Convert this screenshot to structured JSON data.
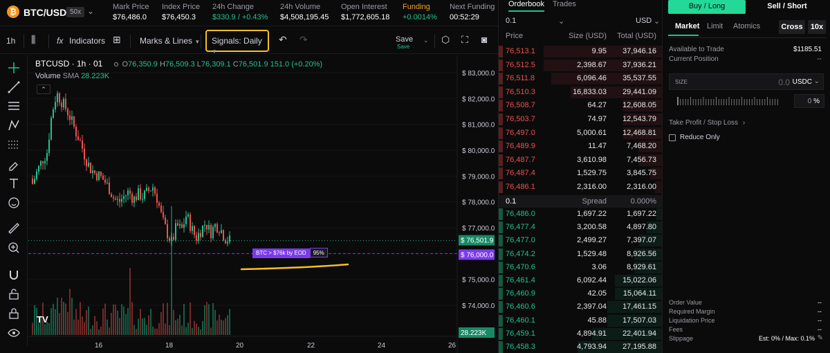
{
  "header": {
    "symbol": "BTC/USD",
    "symbol_icon": "bitcoin-icon",
    "leverage": "50x",
    "stats": [
      {
        "label": "Mark Price",
        "value": "$76,486.0"
      },
      {
        "label": "Index Price",
        "value": "$76,450.3"
      },
      {
        "label": "24h Change",
        "value": "$330.9 / +0.43%"
      },
      {
        "label": "24h Volume",
        "value": "$4,508,195.45"
      },
      {
        "label": "Open Interest",
        "value": "$1,772,605.18"
      },
      {
        "label": "Funding",
        "value": "+0.0014%"
      },
      {
        "label": "Next Funding",
        "value": "00:52:29"
      }
    ]
  },
  "toolbar": {
    "interval": "1h",
    "indicators": "Indicators",
    "marks": "Marks & Lines",
    "signals": "Signals: Daily",
    "save": "Save",
    "save_sub": "Save"
  },
  "chart": {
    "title": "BTCUSD · 1h · 01",
    "ohlc": {
      "o": "76,350.9",
      "h": "76,509.3",
      "l": "76,309.1",
      "c": "76,501.9",
      "chg": "151.0 (+0.20%)"
    },
    "volume_label": "Volume",
    "volume_sma": "SMA",
    "volume_value": "28.223K",
    "signal_text": "BTC > $76k by EOD",
    "signal_pct": "95%",
    "colors": {
      "up": "#22c38e",
      "down": "#f0514b",
      "signal": "#7c3aed",
      "highlight": "#f6c21c"
    }
  },
  "chart_data": {
    "type": "candlestick",
    "y_axis_ticks": [
      "$ 83,000.0",
      "$ 82,000.0",
      "$ 81,000.0",
      "$ 80,000.0",
      "$ 79,000.0",
      "$ 78,000.0",
      "$ 77,000.0",
      "$ 76,000.0",
      "$ 75,000.0",
      "$ 74,000.0"
    ],
    "ylim": [
      73500,
      83500
    ],
    "x_axis_ticks": [
      "16",
      "18",
      "20",
      "22",
      "24",
      "26"
    ],
    "last_price_label": "$ 76,501.9",
    "signal_level_label": "$ 76,000.0",
    "volume_label": "28.223K",
    "close_path": [
      78700,
      79200,
      79600,
      79900,
      81400,
      82200,
      81900,
      81600,
      81200,
      80700,
      80300,
      79700,
      79300,
      79100,
      79000,
      78800,
      78500,
      78100,
      78000,
      78200,
      78400,
      78100,
      78300,
      78200,
      78400,
      78600,
      78100,
      77300,
      76800,
      76400,
      77100,
      76900,
      77500,
      77000,
      76600,
      76900,
      77200,
      76800,
      77100,
      77000,
      76600,
      76500
    ]
  },
  "orderbook": {
    "tabs": [
      "Orderbook",
      "Trades"
    ],
    "precision": "0.1",
    "currency": "USD",
    "columns": [
      "Price",
      "Size (USD)",
      "Total (USD)"
    ],
    "asks": [
      [
        "76,513.1",
        "9.95",
        "37,946.16"
      ],
      [
        "76,512.5",
        "2,398.67",
        "37,936.21"
      ],
      [
        "76,511.8",
        "6,096.46",
        "35,537.55"
      ],
      [
        "76,510.3",
        "16,833.03",
        "29,441.09"
      ],
      [
        "76,508.7",
        "64.27",
        "12,608.05"
      ],
      [
        "76,503.7",
        "74.97",
        "12,543.79"
      ],
      [
        "76,497.0",
        "5,000.61",
        "12,468.81"
      ],
      [
        "76,489.9",
        "11.47",
        "7,468.20"
      ],
      [
        "76,487.7",
        "3,610.98",
        "7,456.73"
      ],
      [
        "76,487.4",
        "1,529.75",
        "3,845.75"
      ],
      [
        "76,486.1",
        "2,316.00",
        "2,316.00"
      ]
    ],
    "spread": {
      "value": "0.1",
      "label": "Spread",
      "pct": "0.000%"
    },
    "bids": [
      [
        "76,486.0",
        "1,697.22",
        "1,697.22"
      ],
      [
        "76,477.4",
        "3,200.58",
        "4,897.80"
      ],
      [
        "76,477.0",
        "2,499.27",
        "7,397.07"
      ],
      [
        "76,474.2",
        "1,529.48",
        "8,926.56"
      ],
      [
        "76,470.6",
        "3.06",
        "8,929.61"
      ],
      [
        "76,461.4",
        "6,092.44",
        "15,022.06"
      ],
      [
        "76,460.9",
        "42.05",
        "15,064.11"
      ],
      [
        "76,460.6",
        "2,397.04",
        "17,461.15"
      ],
      [
        "76,460.1",
        "45.88",
        "17,507.03"
      ],
      [
        "76,459.1",
        "4,894.91",
        "22,401.94"
      ],
      [
        "76,458.3",
        "4,793.94",
        "27,195.88"
      ]
    ]
  },
  "trade": {
    "buy": "Buy / Long",
    "sell": "Sell / Short",
    "order_tabs": [
      "Market",
      "Limit",
      "Atomics"
    ],
    "margin_mode": "Cross",
    "leverage": "10x",
    "available_label": "Available to Trade",
    "available_value": "$1185.51",
    "position_label": "Current Position",
    "position_value": "--",
    "size_label": "SIZE",
    "size_value": "0.0",
    "size_unit": "USDC",
    "size_pct": "0",
    "size_pct_unit": "%",
    "tpsl": "Take Profit / Stop Loss",
    "reduce_only": "Reduce Only",
    "summary": [
      {
        "label": "Order Value",
        "value": "--"
      },
      {
        "label": "Required Margin",
        "value": "--"
      },
      {
        "label": "Liquidation Price",
        "value": "--"
      },
      {
        "label": "Fees",
        "value": "--"
      },
      {
        "label": "Slippage",
        "value": "Est: 0% / Max: 0.1%"
      }
    ]
  }
}
